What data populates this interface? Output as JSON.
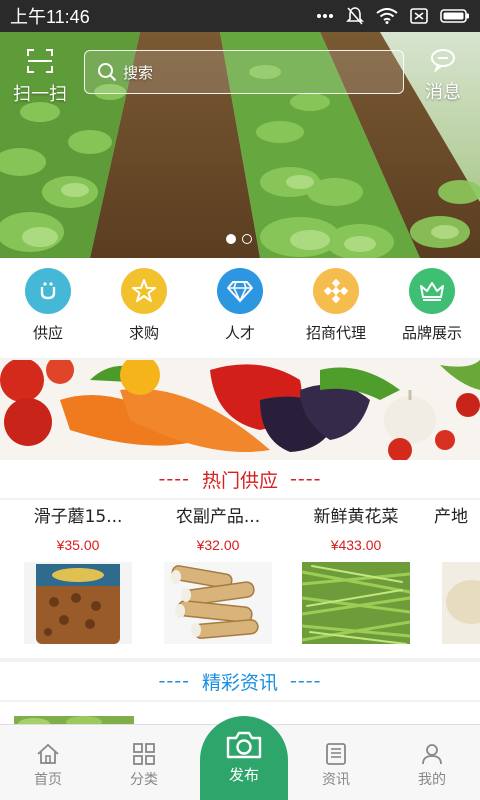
{
  "status_bar": {
    "time": "上午11:46"
  },
  "header": {
    "scan_label": "扫一扫",
    "search_placeholder": "搜索",
    "message_label": "消息"
  },
  "categories": [
    {
      "label": "供应",
      "icon": "supply-icon",
      "color": "#44b8d6"
    },
    {
      "label": "求购",
      "icon": "star-icon",
      "color": "#f2c12e"
    },
    {
      "label": "人才",
      "icon": "diamond-icon",
      "color": "#2c96e0"
    },
    {
      "label": "招商代理",
      "icon": "grid-dots-icon",
      "color": "#f5bd4e"
    },
    {
      "label": "品牌展示",
      "icon": "crown-icon",
      "color": "#3fbf74"
    }
  ],
  "hot_supply": {
    "title": "热门供应",
    "dash": "----",
    "items": [
      {
        "name": "滑子蘑15...",
        "price": "¥35.00"
      },
      {
        "name": "农副产品...",
        "price": "¥32.00"
      },
      {
        "name": "新鲜黄花菜",
        "price": "¥433.00"
      },
      {
        "name": "产地",
        "price": ""
      }
    ]
  },
  "news": {
    "title": "精彩资讯",
    "dash": "----"
  },
  "bottom_nav": {
    "items": [
      {
        "label": "首页",
        "icon": "home-icon"
      },
      {
        "label": "分类",
        "icon": "grid-icon"
      },
      {
        "label": "资讯",
        "icon": "news-icon"
      },
      {
        "label": "我的",
        "icon": "user-icon"
      }
    ],
    "publish_label": "发布"
  },
  "colors": {
    "accent_red": "#d81e1e",
    "accent_blue": "#1a8fe0",
    "publish_green": "#2ea56b"
  }
}
